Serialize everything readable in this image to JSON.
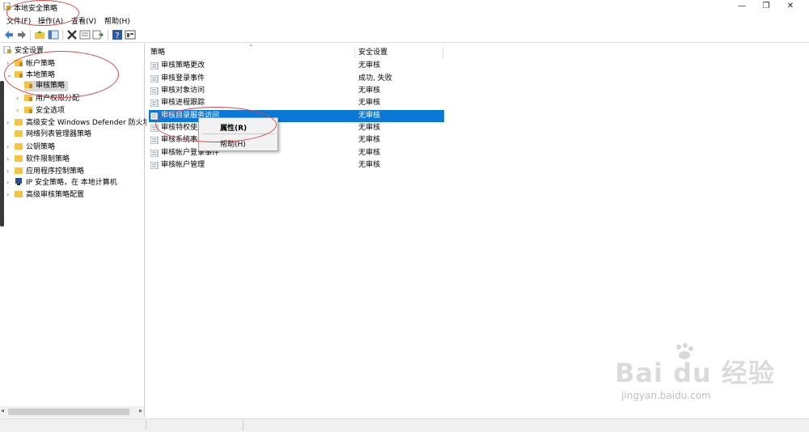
{
  "window": {
    "title": "本地安全策略",
    "controls": {
      "minimize": "—",
      "maximize": "❐",
      "close": "✕"
    }
  },
  "menus": [
    "文件(F)",
    "操作(A)",
    "查看(V)",
    "帮助(H)"
  ],
  "toolbar_icons": [
    "back-arrow-icon",
    "forward-arrow-icon",
    "up-folder-icon",
    "show-hide-tree-icon",
    "delete-icon",
    "properties-icon",
    "export-list-icon",
    "help-icon",
    "console-view-icon"
  ],
  "tree": {
    "root": "安全设置",
    "items": [
      {
        "label": "帐户策略",
        "level": 1,
        "expand": "›"
      },
      {
        "label": "本地策略",
        "level": 1,
        "expand": "⌄"
      },
      {
        "label": "审核策略",
        "level": 2,
        "expand": "",
        "selected": true
      },
      {
        "label": "用户权限分配",
        "level": 2,
        "expand": "›"
      },
      {
        "label": "安全选项",
        "level": 2,
        "expand": "›"
      },
      {
        "label": "高级安全 Windows Defender 防火墙",
        "level": 1,
        "expand": "›"
      },
      {
        "label": "网络列表管理器策略",
        "level": 1,
        "expand": ""
      },
      {
        "label": "公钥策略",
        "level": 1,
        "expand": "›"
      },
      {
        "label": "软件限制策略",
        "level": 1,
        "expand": "›"
      },
      {
        "label": "应用程序控制策略",
        "level": 1,
        "expand": "›"
      },
      {
        "label": "IP 安全策略，在 本地计算机",
        "level": 1,
        "expand": "›"
      },
      {
        "label": "高级审核策略配置",
        "level": 1,
        "expand": "›"
      }
    ]
  },
  "list": {
    "columns": [
      "策略",
      "安全设置"
    ],
    "rows": [
      {
        "name": "审核策略更改",
        "value": "无审核"
      },
      {
        "name": "审核登录事件",
        "value": "成功, 失败"
      },
      {
        "name": "审核对象访问",
        "value": "无审核"
      },
      {
        "name": "审核进程跟踪",
        "value": "无审核"
      },
      {
        "name": "审核目录服务访问",
        "value": "无审核",
        "selected": true
      },
      {
        "name": "审核特权使用",
        "value": "无审核"
      },
      {
        "name": "审核系统事件",
        "value": "无审核"
      },
      {
        "name": "审核帐户登录事件",
        "value": "无审核"
      },
      {
        "name": "审核帐户管理",
        "value": "无审核"
      }
    ]
  },
  "context_menu": {
    "items": [
      "属性(R)",
      "帮助(H)"
    ]
  },
  "watermark": {
    "brand": "Bai du 经验",
    "url": "jingyan.baidu.com"
  },
  "colors": {
    "selection": "#0a78d7",
    "annotation": "#e04545",
    "folder": "#f5c542"
  }
}
